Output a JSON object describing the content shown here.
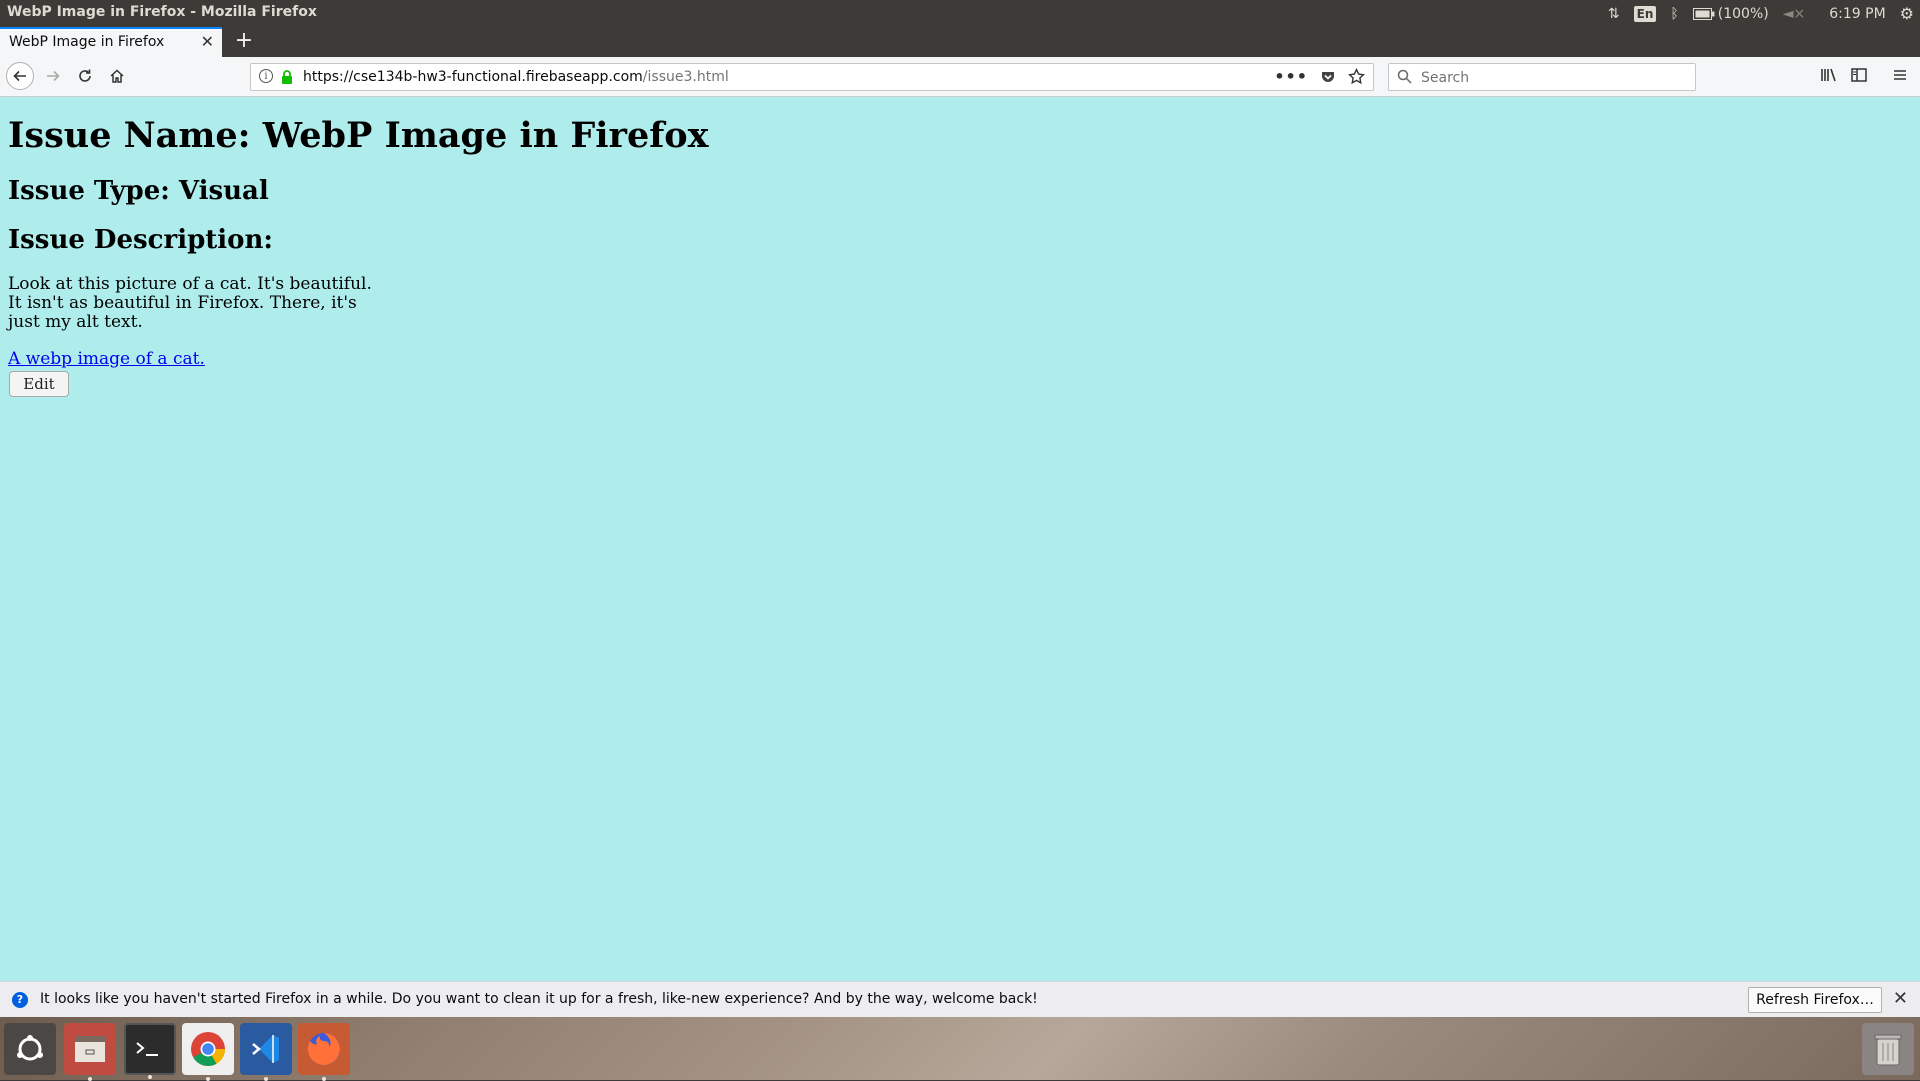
{
  "window": {
    "title": "WebP Image in Firefox - Mozilla Firefox"
  },
  "system_tray": {
    "keyboard_layout": "En",
    "battery_label": "(100%)",
    "time": "6:19 PM"
  },
  "tabs": [
    {
      "label": "WebP Image in Firefox",
      "active": true
    }
  ],
  "navbar": {
    "url_host": "https://cse134b-hw3-functional.firebaseapp.com",
    "url_path": "/issue3.html",
    "search_placeholder": "Search"
  },
  "page": {
    "background": "#afeded",
    "heading": "Issue Name: WebP Image in Firefox",
    "issue_type": "Issue Type: Visual",
    "description_heading": "Issue Description:",
    "description": "Look at this picture of a cat. It's beautiful. It isn't as beautiful in Firefox. There, it's just my alt text.",
    "image_alt_link": "A webp image of a cat.",
    "edit_button": "Edit"
  },
  "notification": {
    "message": "It looks like you haven't started Firefox in a while. Do you want to clean it up for a fresh, like-new experience? And by the way, welcome back!",
    "button": "Refresh Firefox…"
  },
  "dock": {
    "items": [
      "ubuntu-icon",
      "files-icon",
      "terminal-icon",
      "chrome-icon",
      "vscode-icon",
      "firefox-icon",
      "trash-icon"
    ]
  }
}
